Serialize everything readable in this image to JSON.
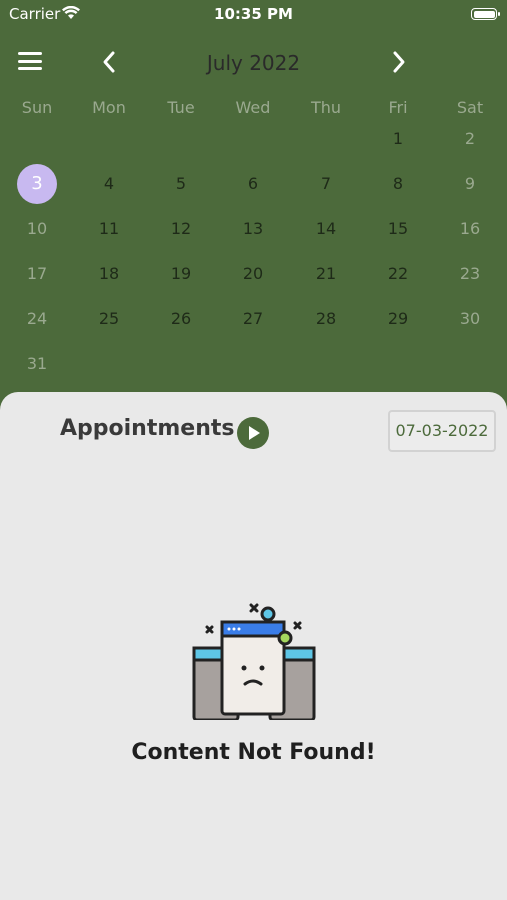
{
  "status_bar": {
    "carrier": "Carrier",
    "time": "10:35 PM"
  },
  "header": {
    "month_title": "July 2022",
    "icons": [
      "menu-icon",
      "chevron-left-icon",
      "chevron-right-icon"
    ]
  },
  "calendar": {
    "weekdays": [
      "Sun",
      "Mon",
      "Tue",
      "Wed",
      "Thu",
      "Fri",
      "Sat"
    ],
    "weeks": [
      [
        "",
        "",
        "",
        "",
        "",
        "1",
        "2"
      ],
      [
        "3",
        "4",
        "5",
        "6",
        "7",
        "8",
        "9"
      ],
      [
        "10",
        "11",
        "12",
        "13",
        "14",
        "15",
        "16"
      ],
      [
        "17",
        "18",
        "19",
        "20",
        "21",
        "22",
        "23"
      ],
      [
        "24",
        "25",
        "26",
        "27",
        "28",
        "29",
        "30"
      ],
      [
        "31",
        "",
        "",
        "",
        "",
        "",
        ""
      ]
    ],
    "selected_day": "3",
    "selected_color": "#c8b9f0"
  },
  "appointments": {
    "label": "Appointments",
    "date": "07-03-2022",
    "empty_message": "Content Not Found!"
  },
  "colors": {
    "primary": "#4c6a3b",
    "panel": "#e9e9e9"
  }
}
